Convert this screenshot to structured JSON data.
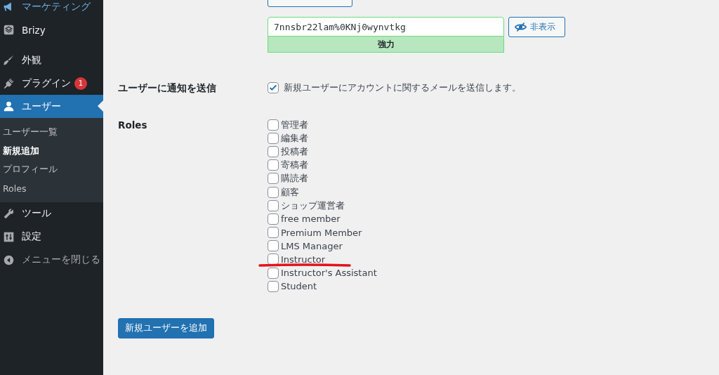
{
  "sidebar": {
    "items": [
      {
        "label": "マーケティング",
        "selected": false,
        "hovered": true
      },
      {
        "label": "Brizy",
        "selected": false,
        "hovered": false
      },
      {
        "label": "外観",
        "selected": false,
        "hovered": false
      },
      {
        "label": "プラグイン",
        "selected": false,
        "hovered": false,
        "badge": "1"
      },
      {
        "label": "ユーザー",
        "selected": true,
        "hovered": false,
        "children": [
          {
            "label": "ユーザー一覧",
            "selected": false
          },
          {
            "label": "新規追加",
            "selected": true
          },
          {
            "label": "プロフィール",
            "selected": false
          },
          {
            "label": "Roles",
            "selected": false
          }
        ]
      },
      {
        "label": "ツール",
        "selected": false,
        "hovered": false
      },
      {
        "label": "設定",
        "selected": false,
        "hovered": false
      },
      {
        "label": "メニューを閉じる",
        "selected": false,
        "hovered": false,
        "kind": "collapse"
      }
    ]
  },
  "password": {
    "value": "7nnsbr22lam%0KNj0wynvtkg",
    "strength": "強力",
    "hide_button": "非表示"
  },
  "notify": {
    "label": "ユーザーに通知を送信",
    "checked": true,
    "text": "新規ユーザーにアカウントに関するメールを送信します。"
  },
  "roles": {
    "label": "Roles",
    "items": [
      {
        "label": "管理者",
        "checked": false
      },
      {
        "label": "編集者",
        "checked": false
      },
      {
        "label": "投稿者",
        "checked": false
      },
      {
        "label": "寄稿者",
        "checked": false
      },
      {
        "label": "購読者",
        "checked": false
      },
      {
        "label": "顧客",
        "checked": false
      },
      {
        "label": "ショップ運営者",
        "checked": false
      },
      {
        "label": "free member",
        "checked": false
      },
      {
        "label": "Premium Member",
        "checked": false
      },
      {
        "label": "LMS Manager",
        "checked": false
      },
      {
        "label": "Instructor",
        "checked": false,
        "underlined": true
      },
      {
        "label": "Instructor's Assistant",
        "checked": false
      },
      {
        "label": "Student",
        "checked": false
      }
    ]
  },
  "submit": "新規ユーザーを追加"
}
